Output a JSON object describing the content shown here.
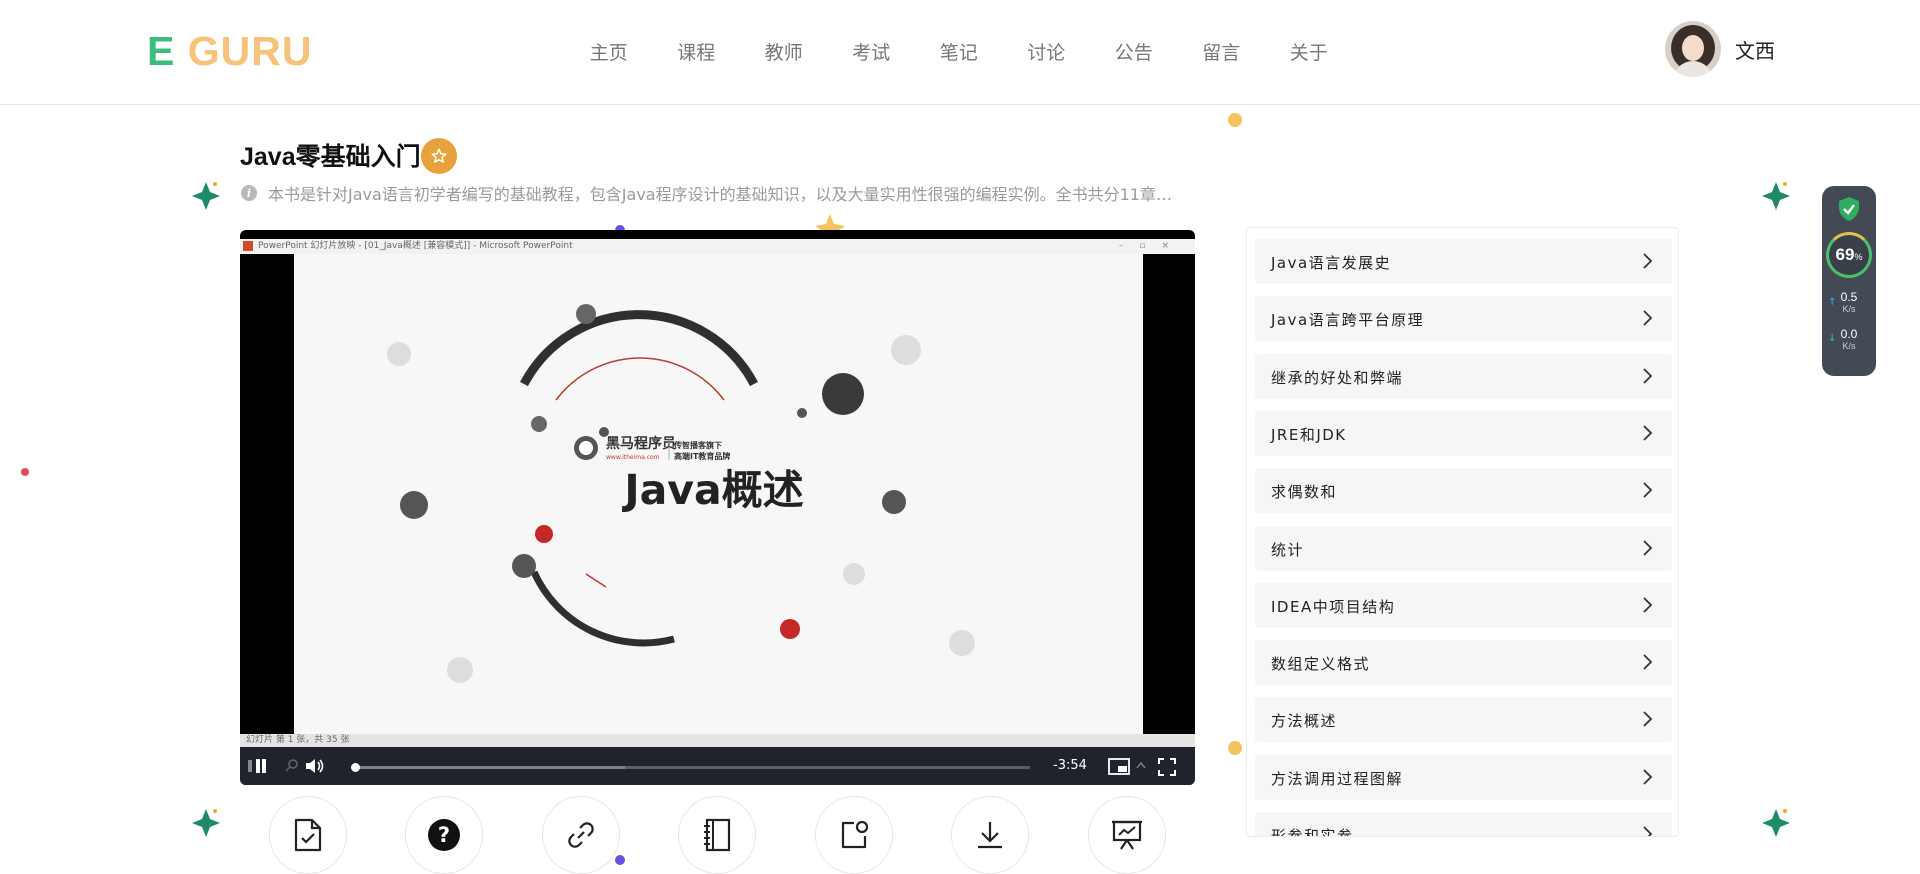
{
  "header": {
    "logo_e": "E",
    "logo_guru": "GURU",
    "nav": [
      "主页",
      "课程",
      "教师",
      "考试",
      "笔记",
      "讨论",
      "公告",
      "留言",
      "关于"
    ],
    "username": "文西"
  },
  "course": {
    "title": "Java零基础入门",
    "description": "本书是针对Java语言初学者编写的基础教程，包含Java程序设计的基础知识，以及大量实用性很强的编程实例。全书共分11章…"
  },
  "player": {
    "window_title": "PowerPoint 幻灯片放映 - [01_Java概述 [兼容模式]] - Microsoft PowerPoint",
    "slide_brand_name": "黑马程序员",
    "slide_brand_site": "www.itheima.com",
    "slide_brand_tag1": "传智播客旗下",
    "slide_brand_tag2": "高端IT教育品牌",
    "slide_heading": "Java概述",
    "slide_status": "幻灯片 第 1 张，共 35 张",
    "time_remaining": "-3:54",
    "progress": 0.0,
    "buffered": 0.4
  },
  "chapters": [
    "Java语言发展史",
    "Java语言跨平台原理",
    "继承的好处和弊端",
    "JRE和JDK",
    "求偶数和",
    "统计",
    "IDEA中项目结构",
    "数组定义格式",
    "方法概述",
    "方法调用过程图解",
    "形参和实参"
  ],
  "actions": [
    "homework-icon",
    "question-icon",
    "link-icon",
    "notebook-icon",
    "note-icon",
    "download-icon",
    "presentation-icon"
  ],
  "network_widget": {
    "percent": "69",
    "percent_unit": "%",
    "upload": "0.5",
    "download": "0.0",
    "unit": "K/s"
  },
  "colors": {
    "accent_green": "#3dbd7d",
    "accent_orange": "#f7c27a",
    "favorite": "#e8a23b",
    "player_bar": "#20232b"
  }
}
